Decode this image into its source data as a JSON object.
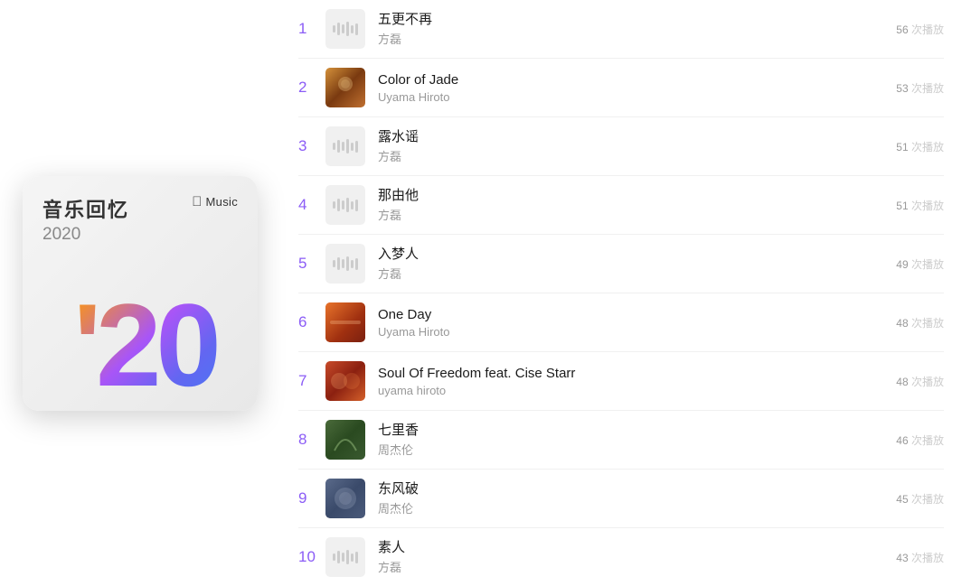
{
  "album": {
    "title_cn": "音乐回忆",
    "year": "2020",
    "brand": "Music",
    "big_year": "'20"
  },
  "tracks": [
    {
      "rank": "1",
      "name": "五更不再",
      "artist": "方磊",
      "plays_count": "56",
      "plays_label": "次播放",
      "has_art": false
    },
    {
      "rank": "2",
      "name": "Color of Jade",
      "artist": "Uyama Hiroto",
      "plays_count": "53",
      "plays_label": "次播放",
      "has_art": true,
      "art_type": "color-jade"
    },
    {
      "rank": "3",
      "name": "露水谣",
      "artist": "方磊",
      "plays_count": "51",
      "plays_label": "次播放",
      "has_art": false
    },
    {
      "rank": "4",
      "name": "那由他",
      "artist": "方磊",
      "plays_count": "51",
      "plays_label": "次播放",
      "has_art": false
    },
    {
      "rank": "5",
      "name": "入梦人",
      "artist": "方磊",
      "plays_count": "49",
      "plays_label": "次播放",
      "has_art": false
    },
    {
      "rank": "6",
      "name": "One Day",
      "artist": "Uyama Hiroto",
      "plays_count": "48",
      "plays_label": "次播放",
      "has_art": true,
      "art_type": "one-day"
    },
    {
      "rank": "7",
      "name": "Soul Of Freedom feat. Cise Starr",
      "artist": "uyama hiroto",
      "plays_count": "48",
      "plays_label": "次播放",
      "has_art": true,
      "art_type": "soul-of-freedom"
    },
    {
      "rank": "8",
      "name": "七里香",
      "artist": "周杰伦",
      "plays_count": "46",
      "plays_label": "次播放",
      "has_art": true,
      "art_type": "qi-li-xiang"
    },
    {
      "rank": "9",
      "name": "东风破",
      "artist": "周杰伦",
      "plays_count": "45",
      "plays_label": "次播放",
      "has_art": true,
      "art_type": "dong-feng"
    },
    {
      "rank": "10",
      "name": "素人",
      "artist": "方磊",
      "plays_count": "43",
      "plays_label": "次播放",
      "has_art": false
    }
  ]
}
